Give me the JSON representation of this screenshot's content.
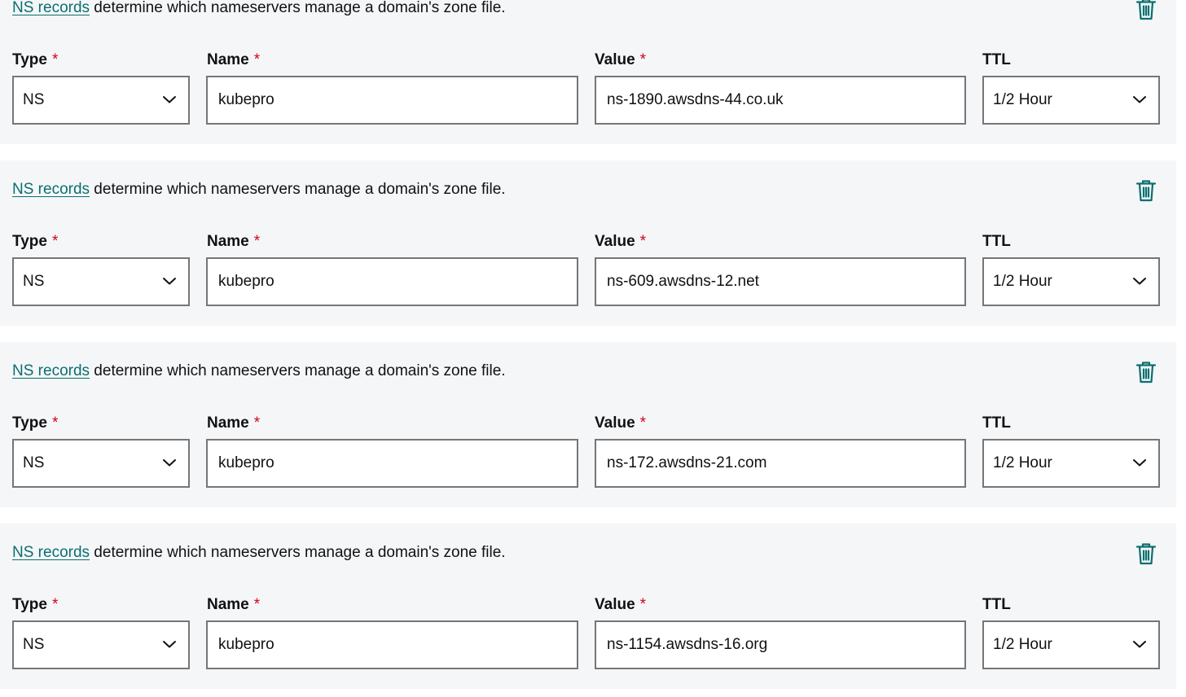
{
  "labels": {
    "type": "Type",
    "name": "Name",
    "value": "Value",
    "ttl": "TTL",
    "required_marker": "*"
  },
  "description": {
    "link_text": "NS records",
    "text": " determine which nameservers manage a domain's zone file."
  },
  "records": [
    {
      "type": "NS",
      "name": "kubepro",
      "value": "ns-1890.awsdns-44.co.uk",
      "ttl": "1/2 Hour"
    },
    {
      "type": "NS",
      "name": "kubepro",
      "value": "ns-609.awsdns-12.net",
      "ttl": "1/2 Hour"
    },
    {
      "type": "NS",
      "name": "kubepro",
      "value": "ns-172.awsdns-21.com",
      "ttl": "1/2 Hour"
    },
    {
      "type": "NS",
      "name": "kubepro",
      "value": "ns-1154.awsdns-16.org",
      "ttl": "1/2 Hour"
    }
  ],
  "colors": {
    "link": "#0a6f6f",
    "icon": "#0a6f6f",
    "required": "#d0021b",
    "card_bg": "#f5f6f8",
    "field_border": "#767676"
  },
  "icons": {
    "delete": "trash-icon",
    "dropdown": "chevron-down-icon"
  }
}
